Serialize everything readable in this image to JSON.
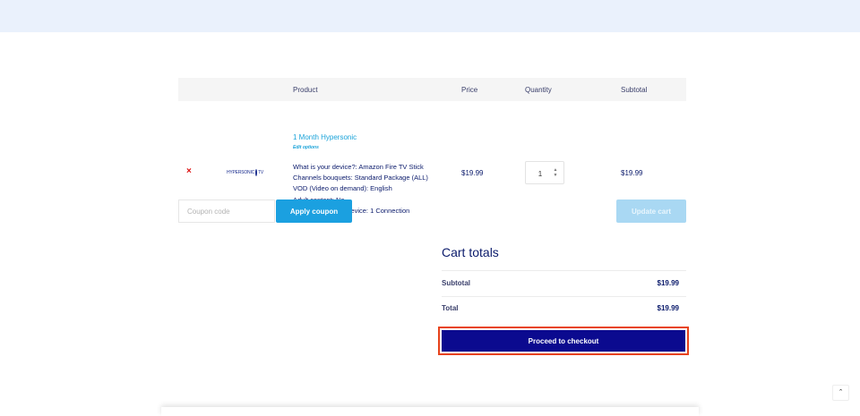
{
  "cart": {
    "headers": {
      "product": "Product",
      "price": "Price",
      "quantity": "Quantity",
      "subtotal": "Subtotal"
    },
    "item": {
      "remove_glyph": "×",
      "thumb_text": "HYPERSONIC",
      "thumb_suffix": "TV",
      "name": "1 Month Hypersonic",
      "edit_options": "Edit options",
      "meta": [
        "What is your device?: Amazon Fire TV Stick",
        "Channels bouquets: Standard Package (ALL)",
        "VOD (Video on demand): English",
        "Adult content: No",
        "1 Connection = 1 Device: 1 Connection"
      ],
      "price": "$19.99",
      "quantity": "1",
      "subtotal": "$19.99"
    },
    "coupon_placeholder": "Coupon code",
    "apply_coupon": "Apply coupon",
    "update_cart": "Update cart"
  },
  "totals": {
    "title": "Cart totals",
    "subtotal_label": "Subtotal",
    "subtotal_value": "$19.99",
    "total_label": "Total",
    "total_value": "$19.99",
    "checkout": "Proceed to checkout"
  },
  "scroll_top_icon": "chevron-up-icon",
  "colors": {
    "accent": "#1ba0e0",
    "checkout": "#0b0a8f",
    "highlight": "#e8431c",
    "text": "#0a1a6b"
  }
}
